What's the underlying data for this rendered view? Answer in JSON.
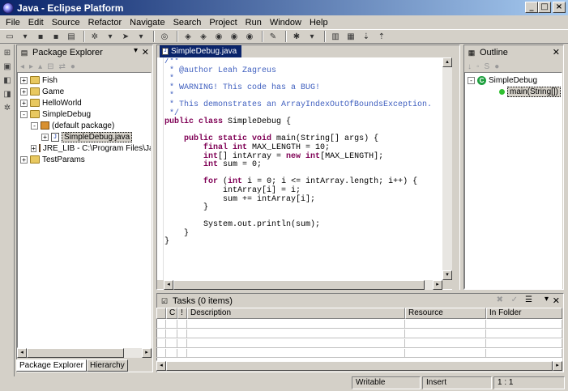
{
  "window": {
    "title": "Java - Eclipse Platform"
  },
  "menu": [
    "File",
    "Edit",
    "Source",
    "Refactor",
    "Navigate",
    "Search",
    "Project",
    "Run",
    "Window",
    "Help"
  ],
  "package_explorer": {
    "title": "Package Explorer",
    "tree": [
      {
        "label": "Fish",
        "level": 0,
        "expander": "+",
        "icon": "folder"
      },
      {
        "label": "Game",
        "level": 0,
        "expander": "+",
        "icon": "folder"
      },
      {
        "label": "HelloWorld",
        "level": 0,
        "expander": "+",
        "icon": "folder"
      },
      {
        "label": "SimpleDebug",
        "level": 0,
        "expander": "-",
        "icon": "folder"
      },
      {
        "label": "(default package)",
        "level": 1,
        "expander": "-",
        "icon": "package"
      },
      {
        "label": "SimpleDebug.java",
        "level": 2,
        "expander": "+",
        "icon": "java-file",
        "selected": true
      },
      {
        "label": "JRE_LIB - C:\\Program Files\\Jav",
        "level": 1,
        "expander": "+",
        "icon": "jar"
      },
      {
        "label": "TestParams",
        "level": 0,
        "expander": "+",
        "icon": "folder"
      }
    ],
    "tabs": [
      "Package Explorer",
      "Hierarchy"
    ]
  },
  "editor": {
    "tab_label": "SimpleDebug.java",
    "code_lines": [
      [
        {
          "t": "/**",
          "c": "cm"
        }
      ],
      [
        {
          "t": " * @author Leah Zagreus",
          "c": "cm"
        }
      ],
      [
        {
          "t": " *",
          "c": "cm"
        }
      ],
      [
        {
          "t": " * WARNING! This code has a BUG!",
          "c": "cm"
        }
      ],
      [
        {
          "t": " *",
          "c": "cm"
        }
      ],
      [
        {
          "t": " * This demonstrates an ArrayIndexOutOfBoundsException.",
          "c": "cm"
        }
      ],
      [
        {
          "t": " */",
          "c": "cm"
        }
      ],
      [
        {
          "t": "public class",
          "c": "kw"
        },
        {
          "t": " SimpleDebug {",
          "c": ""
        }
      ],
      [
        {
          "t": "",
          "c": ""
        }
      ],
      [
        {
          "t": "    ",
          "c": ""
        },
        {
          "t": "public static void",
          "c": "kw"
        },
        {
          "t": " main(String[] args) {",
          "c": ""
        }
      ],
      [
        {
          "t": "        ",
          "c": ""
        },
        {
          "t": "final int",
          "c": "kw"
        },
        {
          "t": " MAX_LENGTH = 10;",
          "c": ""
        }
      ],
      [
        {
          "t": "        ",
          "c": ""
        },
        {
          "t": "int",
          "c": "kw"
        },
        {
          "t": "[] intArray = ",
          "c": ""
        },
        {
          "t": "new int",
          "c": "kw"
        },
        {
          "t": "[MAX_LENGTH];",
          "c": ""
        }
      ],
      [
        {
          "t": "        ",
          "c": ""
        },
        {
          "t": "int",
          "c": "kw"
        },
        {
          "t": " sum = 0;",
          "c": ""
        }
      ],
      [
        {
          "t": "",
          "c": ""
        }
      ],
      [
        {
          "t": "        ",
          "c": ""
        },
        {
          "t": "for",
          "c": "kw"
        },
        {
          "t": " (",
          "c": ""
        },
        {
          "t": "int",
          "c": "kw"
        },
        {
          "t": " i = 0; i <= intArray.length; i++) {",
          "c": ""
        }
      ],
      [
        {
          "t": "            intArray[i] = i;",
          "c": ""
        }
      ],
      [
        {
          "t": "            sum += intArray[i];",
          "c": ""
        }
      ],
      [
        {
          "t": "        }",
          "c": ""
        }
      ],
      [
        {
          "t": "",
          "c": ""
        }
      ],
      [
        {
          "t": "        System.out.println(sum);",
          "c": ""
        }
      ],
      [
        {
          "t": "    }",
          "c": ""
        }
      ],
      [
        {
          "t": "}",
          "c": ""
        }
      ]
    ]
  },
  "outline": {
    "title": "Outline",
    "class_name": "SimpleDebug",
    "method_name": "main(String[])"
  },
  "tasks": {
    "title": "Tasks (0 items)",
    "columns": [
      "",
      "C",
      "!",
      "Description",
      "Resource",
      "In Folder"
    ]
  },
  "status": {
    "mode": "Writable",
    "insert": "Insert",
    "position": "1 : 1"
  }
}
